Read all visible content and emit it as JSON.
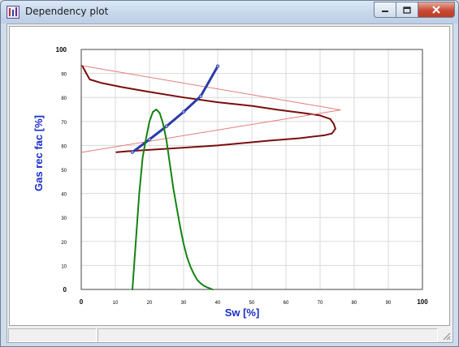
{
  "window": {
    "title": "Dependency plot"
  },
  "colors": {
    "axis_label": "#1a2cc8",
    "tick_label": "#000000"
  },
  "chart_data": {
    "type": "line",
    "xlabel": "Sw [%]",
    "ylabel": "Gas rec fac [%]",
    "xlim": [
      0,
      100
    ],
    "ylim": [
      0,
      100
    ],
    "x_ticks": [
      "0",
      "10",
      "20",
      "30",
      "40",
      "50",
      "60",
      "70",
      "80",
      "90",
      "100"
    ],
    "y_ticks": [
      "0",
      "10",
      "20",
      "30",
      "40",
      "50",
      "60",
      "70",
      "80",
      "90",
      "100"
    ],
    "grid": true,
    "series": [
      {
        "color": "#7a0d0d",
        "points": [
          [
            0.3,
            93.2
          ],
          [
            1.5,
            90
          ],
          [
            2.5,
            87.5
          ],
          [
            6,
            86
          ],
          [
            12,
            84.3
          ],
          [
            20,
            82.3
          ],
          [
            30,
            80
          ],
          [
            40,
            78
          ],
          [
            50,
            76.5
          ],
          [
            58,
            74.8
          ],
          [
            65,
            73.5
          ],
          [
            70,
            72.5
          ],
          [
            73,
            71
          ],
          [
            74,
            69
          ],
          [
            74.5,
            67
          ],
          [
            73.5,
            65
          ],
          [
            71.5,
            64.3
          ],
          [
            64,
            63
          ],
          [
            55,
            62
          ],
          [
            40,
            60
          ],
          [
            25,
            58.6
          ],
          [
            16,
            57.8
          ],
          [
            13,
            57.5
          ],
          [
            10.3,
            57.2
          ]
        ]
      },
      {
        "color": "#e37c7c",
        "points": [
          [
            0.3,
            93.2
          ],
          [
            76,
            74.8
          ],
          [
            0.3,
            57.2
          ]
        ]
      },
      {
        "color": "#2a3aa8",
        "points": [
          [
            15,
            57.2
          ],
          [
            20,
            62.5
          ],
          [
            25,
            68
          ],
          [
            30,
            74
          ],
          [
            35,
            80.5
          ],
          [
            40,
            93
          ]
        ]
      },
      {
        "color": "#158215",
        "points": [
          [
            15,
            0
          ],
          [
            16,
            20
          ],
          [
            17,
            40
          ],
          [
            18,
            55
          ],
          [
            19,
            63
          ],
          [
            20,
            70
          ],
          [
            21,
            74
          ],
          [
            22,
            75
          ],
          [
            23,
            73.5
          ],
          [
            24,
            69
          ],
          [
            25,
            62
          ],
          [
            26,
            52
          ],
          [
            27,
            42
          ],
          [
            28,
            34
          ],
          [
            29,
            26
          ],
          [
            30,
            19
          ],
          [
            31,
            13.5
          ],
          [
            32,
            9.5
          ],
          [
            33,
            6.5
          ],
          [
            34,
            4
          ],
          [
            35,
            2.5
          ],
          [
            36,
            1.5
          ],
          [
            37,
            0.8
          ],
          [
            38.5,
            0
          ]
        ]
      }
    ]
  }
}
